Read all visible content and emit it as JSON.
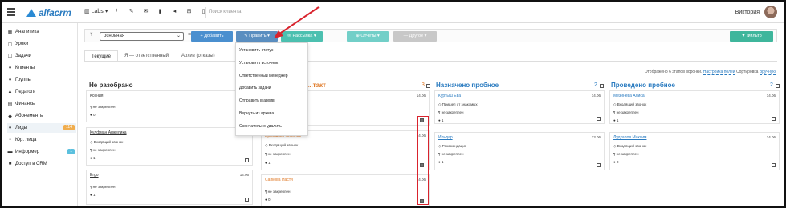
{
  "topbar": {
    "logo": "alfacrm",
    "branch": "Labs",
    "search_placeholder": "Поиск клиента",
    "user_name": "Виктория",
    "icons": [
      "plus-icon",
      "wrench-icon",
      "mail-icon",
      "file-icon",
      "send-icon",
      "cart-icon",
      "doc-icon"
    ]
  },
  "sidebar": {
    "items": [
      {
        "label": "Аналитика",
        "icon": "chart-icon"
      },
      {
        "label": "Уроки",
        "icon": "calendar-icon"
      },
      {
        "label": "Задачи",
        "icon": "tasks-icon"
      },
      {
        "label": "Клиенты",
        "icon": "user-icon"
      },
      {
        "label": "Группы",
        "icon": "group-icon"
      },
      {
        "label": "Педагоги",
        "icon": "teacher-icon"
      },
      {
        "label": "Финансы",
        "icon": "finance-icon"
      },
      {
        "label": "Абонементы",
        "icon": "tag-icon"
      },
      {
        "label": "Лиды",
        "icon": "leads-icon",
        "badge": "114",
        "badge_color": "#f0ad4e"
      },
      {
        "label": "Юр. лица",
        "icon": "building-icon"
      },
      {
        "label": "Информер",
        "icon": "informer-icon",
        "badge": "1",
        "badge_color": "#5bc0de"
      },
      {
        "label": "Доступ в CRM",
        "icon": "lock-icon"
      }
    ]
  },
  "toolbar": {
    "select_value": "основная",
    "add_label": "+ Добавить",
    "edit_label": "✎ Править ▾",
    "mailing_label": "✉ Рассылка ▾",
    "reports_label": "⊕ Отчеты ▾",
    "other_label": "— Другое ▾",
    "filter_label": "▼ Фильтр",
    "colors": {
      "add": "#4a8fcf",
      "edit": "#5a8ec0",
      "mailing": "#4cc0b0",
      "reports": "#72cfc8",
      "other": "#c8c8c8",
      "filter": "#3fb69c"
    }
  },
  "tabs": [
    {
      "label": "Текущие",
      "active": true
    },
    {
      "label": "Я — ответственный",
      "active": false
    },
    {
      "label": "Архив (отказы)",
      "active": false
    }
  ],
  "info": {
    "prefix": "Отображено 6 этапов воронки.",
    "configure": "Настройка полей",
    "sort_label": "Сортировка",
    "sort_value": "Вручную"
  },
  "dropdown": {
    "items": [
      "Установить статус",
      "Установить источник",
      "Ответственный менеджер",
      "Добавить задачи",
      "Отправить в архив",
      "Вернуть из архива",
      "Окончательно удалить"
    ]
  },
  "columns": [
    {
      "title": "Не разобрано",
      "count": "",
      "color": "#333333",
      "cards": [
        {
          "name": "Ксения",
          "date": "",
          "lines": [
            "¶ не закреплен",
            "● 0"
          ],
          "checked": false
        },
        {
          "name": "Кулфман Анжелика",
          "date": "",
          "lines": [
            "◇ Входящий звонок",
            "¶ не закреплен",
            "● 1"
          ],
          "checked": false
        },
        {
          "name": "Ergo",
          "date": "14.06",
          "lines": [
            "¶ не закреплен",
            "● 1"
          ],
          "checked": false
        }
      ]
    },
    {
      "title": "...такт",
      "count": "3",
      "color": "#e07b2a",
      "cards": [
        {
          "name": "",
          "date": "14.06",
          "lines": [],
          "checked": true
        },
        {
          "name": "Ермошкин Николай",
          "date": "14.06",
          "lines": [
            "◇ Входящий звонок",
            "¶ не закреплен",
            "● 1"
          ],
          "checked": true
        },
        {
          "name": "Сапкова Настя",
          "date": "14.06",
          "lines": [
            "¶ не закреплен",
            "● 0"
          ],
          "checked": true
        }
      ]
    },
    {
      "title": "Назначено пробное",
      "count": "2",
      "color": "#2a7bc0",
      "cards": [
        {
          "name": "Куртыш Ева",
          "date": "14.06",
          "lines": [
            "◇ Пришел от знакомых",
            "¶ не закреплен",
            "● 1"
          ],
          "checked": false
        },
        {
          "name": "Ильдар",
          "date": "13.06",
          "lines": [
            "◇ Рекомендация",
            "¶ не закреплен",
            "● 1"
          ],
          "checked": false
        }
      ]
    },
    {
      "title": "Проведено пробное",
      "count": "2",
      "color": "#2a7bc0",
      "cards": [
        {
          "name": "Мезинёва Алиса",
          "date": "14.06",
          "lines": [
            "◇ Входящий звонок",
            "¶ не закреплен",
            "● 1"
          ],
          "checked": false
        },
        {
          "name": "Лудкалов Максим",
          "date": "14.06",
          "lines": [
            "◇ Входящий звонок",
            "¶ не закреплен",
            "● 0"
          ],
          "checked": false
        }
      ]
    }
  ]
}
